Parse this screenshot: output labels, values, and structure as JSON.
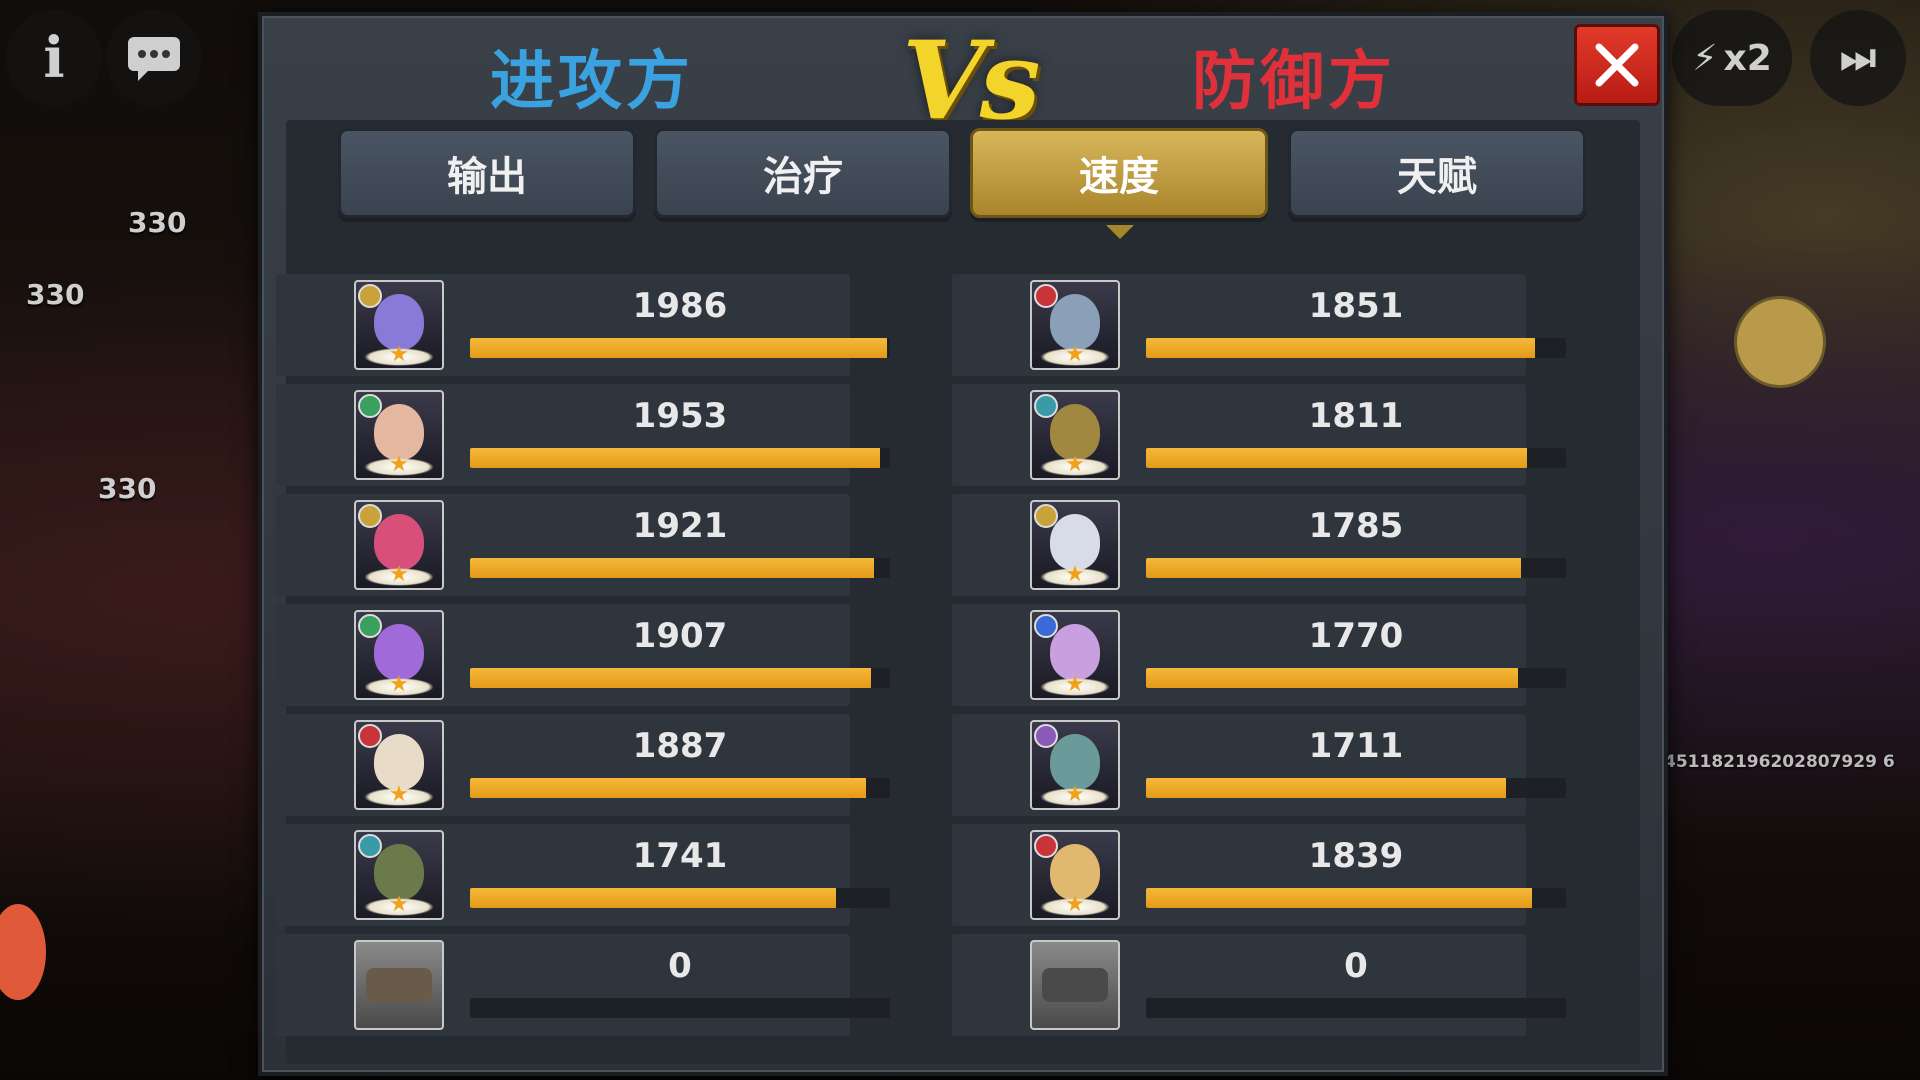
{
  "hud": {
    "left_numbers": [
      "330",
      "330",
      "330"
    ],
    "speed_label": "x2",
    "seed_text": "451182196202807929 6"
  },
  "dialog": {
    "attacker_title": "进攻方",
    "vs_label": "Vs",
    "defender_title": "防御方",
    "close_icon": "close-icon"
  },
  "tabs": [
    {
      "label": "输出",
      "active": false
    },
    {
      "label": "治疗",
      "active": false
    },
    {
      "label": "速度",
      "active": true
    },
    {
      "label": "天赋",
      "active": false
    }
  ],
  "max_value": 2000,
  "attackers": [
    {
      "value": "1986",
      "ratio": 0.993,
      "face": "#8a7ad8",
      "badge": "#c9a23a"
    },
    {
      "value": "1953",
      "ratio": 0.977,
      "face": "#e4b8a0",
      "badge": "#3aa060"
    },
    {
      "value": "1921",
      "ratio": 0.961,
      "face": "#d8507a",
      "badge": "#c9a23a"
    },
    {
      "value": "1907",
      "ratio": 0.954,
      "face": "#a06ad8",
      "badge": "#3aa060"
    },
    {
      "value": "1887",
      "ratio": 0.944,
      "face": "#e8dcc8",
      "badge": "#c8343a"
    },
    {
      "value": "1741",
      "ratio": 0.871,
      "face": "#6a7a4a",
      "badge": "#3a9aa8"
    },
    {
      "value": "0",
      "ratio": 0,
      "face": "#6a5a4a",
      "badge": "none",
      "vehicle": true
    }
  ],
  "defenders": [
    {
      "value": "1851",
      "ratio": 0.926,
      "face": "#8aa0b8",
      "badge": "#c8343a"
    },
    {
      "value": "1811",
      "ratio": 0.906,
      "face": "#a08840",
      "badge": "#3a9aa8"
    },
    {
      "value": "1785",
      "ratio": 0.893,
      "face": "#d8dce8",
      "badge": "#c9a23a"
    },
    {
      "value": "1770",
      "ratio": 0.885,
      "face": "#c8a0e0",
      "badge": "#3a6ad8"
    },
    {
      "value": "1711",
      "ratio": 0.856,
      "face": "#6a9a9a",
      "badge": "#8a5ab8"
    },
    {
      "value": "1839",
      "ratio": 0.92,
      "face": "#e0b870",
      "badge": "#c8343a"
    },
    {
      "value": "0",
      "ratio": 0,
      "face": "#4a4a4a",
      "badge": "none",
      "vehicle": true
    }
  ]
}
